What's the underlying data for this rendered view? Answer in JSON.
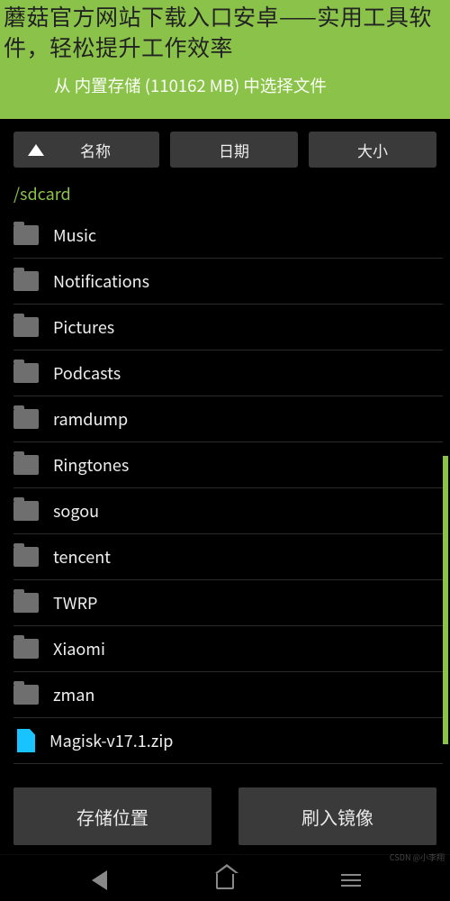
{
  "overlay_text": "蘑菇官方网站下载入口安卓——实用工具软件，轻松提升工作效率",
  "header": {
    "chevron_name": "chevron-right-icon",
    "subtitle": "从 内置存储 (110162 MB) 中选择文件"
  },
  "sort": {
    "name": "名称",
    "date": "日期",
    "size": "大小",
    "active": "name"
  },
  "current_path": "/sdcard",
  "files": [
    {
      "type": "folder",
      "name": "Music"
    },
    {
      "type": "folder",
      "name": "Notifications"
    },
    {
      "type": "folder",
      "name": "Pictures"
    },
    {
      "type": "folder",
      "name": "Podcasts"
    },
    {
      "type": "folder",
      "name": "ramdump"
    },
    {
      "type": "folder",
      "name": "Ringtones"
    },
    {
      "type": "folder",
      "name": "sogou"
    },
    {
      "type": "folder",
      "name": "tencent"
    },
    {
      "type": "folder",
      "name": "TWRP"
    },
    {
      "type": "folder",
      "name": "Xiaomi"
    },
    {
      "type": "folder",
      "name": "zman"
    },
    {
      "type": "file",
      "name": "Magisk-v17.1.zip"
    }
  ],
  "buttons": {
    "storage": "存储位置",
    "flash": "刷入镜像"
  },
  "watermark": "CSDN @小李翔"
}
